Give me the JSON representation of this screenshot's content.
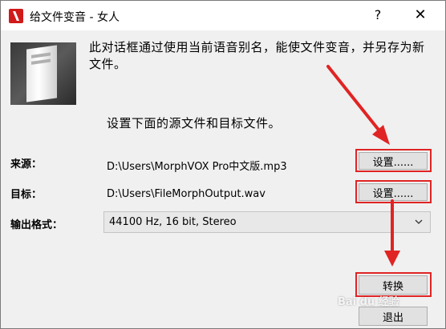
{
  "window": {
    "title": "给文件变音 - 女人",
    "help_glyph": "?",
    "close_glyph": "✕"
  },
  "dialog": {
    "description": "此对话框通过使用当前语音别名，能使文件变音，并另存为新文件。",
    "instruction": "设置下面的源文件和目标文件。",
    "source_label": "来源：",
    "source_path": "D:\\Users\\MorphVOX Pro中文版.mp3",
    "source_button": "设置......",
    "target_label": "目标：",
    "target_path": "D:\\Users\\FileMorphOutput.wav",
    "target_button": "设置......",
    "format_label": "输出格式：",
    "format_value": "44100 Hz, 16 bit, Stereo",
    "convert_button": "转换",
    "exit_button": "退出"
  },
  "watermark": "Bai du 经验",
  "colors": {
    "annotation": "#e02424"
  }
}
